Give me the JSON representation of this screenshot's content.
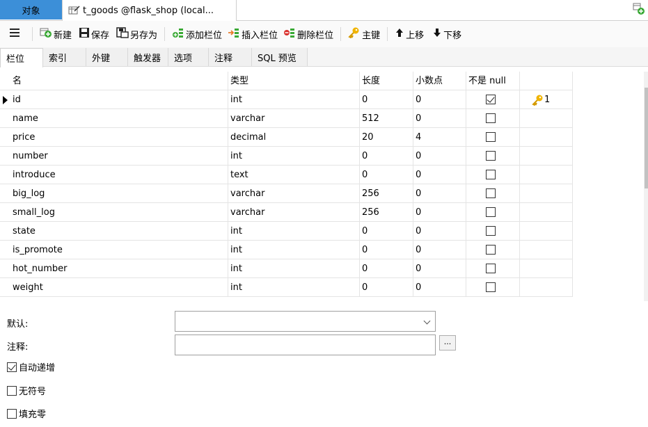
{
  "tabs": {
    "objects_label": "对象",
    "table_tab_label": "t_goods @flask_shop (local..."
  },
  "toolbar": {
    "new_label": "新建",
    "save_label": "保存",
    "save_as_label": "另存为",
    "add_column_label": "添加栏位",
    "insert_column_label": "插入栏位",
    "delete_column_label": "删除栏位",
    "primary_key_label": "主键",
    "move_up_label": "上移",
    "move_down_label": "下移"
  },
  "subtabs": [
    "栏位",
    "索引",
    "外键",
    "触发器",
    "选项",
    "注释",
    "SQL 预览"
  ],
  "grid": {
    "headers": [
      "名",
      "类型",
      "长度",
      "小数点",
      "不是 null",
      ""
    ],
    "rows": [
      {
        "name": "id",
        "type": "int",
        "length": "0",
        "decimals": "0",
        "not_null": true,
        "key": "1"
      },
      {
        "name": "name",
        "type": "varchar",
        "length": "512",
        "decimals": "0",
        "not_null": false,
        "key": ""
      },
      {
        "name": "price",
        "type": "decimal",
        "length": "20",
        "decimals": "4",
        "not_null": false,
        "key": ""
      },
      {
        "name": "number",
        "type": "int",
        "length": "0",
        "decimals": "0",
        "not_null": false,
        "key": ""
      },
      {
        "name": "introduce",
        "type": "text",
        "length": "0",
        "decimals": "0",
        "not_null": false,
        "key": ""
      },
      {
        "name": "big_log",
        "type": "varchar",
        "length": "256",
        "decimals": "0",
        "not_null": false,
        "key": ""
      },
      {
        "name": "small_log",
        "type": "varchar",
        "length": "256",
        "decimals": "0",
        "not_null": false,
        "key": ""
      },
      {
        "name": "state",
        "type": "int",
        "length": "0",
        "decimals": "0",
        "not_null": false,
        "key": ""
      },
      {
        "name": "is_promote",
        "type": "int",
        "length": "0",
        "decimals": "0",
        "not_null": false,
        "key": ""
      },
      {
        "name": "hot_number",
        "type": "int",
        "length": "0",
        "decimals": "0",
        "not_null": false,
        "key": ""
      },
      {
        "name": "weight",
        "type": "int",
        "length": "0",
        "decimals": "0",
        "not_null": false,
        "key": ""
      }
    ]
  },
  "properties": {
    "default_label": "默认:",
    "default_value": "",
    "comment_label": "注释:",
    "comment_value": "",
    "ellipsis_label": "...",
    "auto_increment_label": "自动递增",
    "auto_increment_checked": true,
    "unsigned_label": "无符号",
    "unsigned_checked": false,
    "zerofill_label": "填充零",
    "zerofill_checked": false
  },
  "colors": {
    "active_tab": "#3c8fd8",
    "key_icon": "#f0b400",
    "add_green": "#3aa935",
    "insert_orange": "#e87b2a",
    "delete_red": "#d9302c"
  }
}
